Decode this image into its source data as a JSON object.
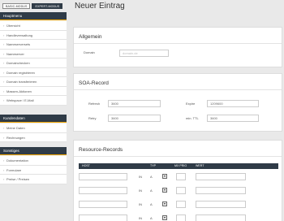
{
  "modes": {
    "basic": "BASIC-MODUS",
    "expert": "EXPERT-MODUS"
  },
  "sidebar": {
    "hauptmenu": {
      "title": "Hauptmenu",
      "items": [
        "Übersicht",
        "Handleverwaltung",
        "Nameserversets",
        "Nameserver",
        "Domainchecken",
        "Domain registrieren",
        "Domain transferieren",
        "Massen-Aktionen",
        "Webspace / E-Mail"
      ]
    },
    "kundendaten": {
      "title": "Kundendaten",
      "items": [
        "Meine Daten",
        "Rechnungen"
      ]
    },
    "sonstiges": {
      "title": "Sonstiges",
      "items": [
        "Dokumentation",
        "Formulare",
        "Preise / Preisen"
      ]
    }
  },
  "main": {
    "title": "Neuer Eintrag",
    "allgemein": {
      "title": "Allgemein",
      "domain_label": "Domain",
      "domain_placeholder": "domain.de"
    },
    "soa": {
      "title": "SOA-Record",
      "refresh_label": "Refresh",
      "refresh_value": "3600",
      "retry_label": "Retry",
      "retry_value": "3600",
      "expire_label": "Expire",
      "expire_value": "1209600",
      "minttl_label": "min. TTL",
      "minttl_value": "3600"
    },
    "rr": {
      "title": "Resource-Records",
      "headers": {
        "host": "HOST",
        "typ": "TYP",
        "mxprio": "MX PRIO",
        "wert": "WERT"
      },
      "in_label": "IN",
      "type_value": "A",
      "dropdown_icon": "▼"
    }
  }
}
